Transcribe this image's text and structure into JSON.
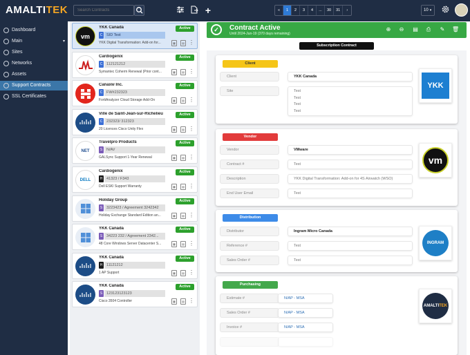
{
  "app": {
    "logo_part1": "AMALTI",
    "logo_part2": "TEK"
  },
  "search": {
    "placeholder": "Search Contracts"
  },
  "pager": {
    "pages": [
      "1",
      "2",
      "3",
      "4",
      "...",
      "30",
      "31"
    ],
    "prev": "‹",
    "next": "›",
    "first": "«",
    "last": "»"
  },
  "page_size": "10",
  "sidebar": {
    "items": [
      {
        "label": "Dashboard"
      },
      {
        "label": "Main"
      },
      {
        "label": "Sites"
      },
      {
        "label": "Networks"
      },
      {
        "label": "Assets"
      },
      {
        "label": "Support Contracts"
      },
      {
        "label": "SSL Certificates"
      }
    ]
  },
  "contracts": [
    {
      "name": "YKK Canada",
      "type": "C",
      "ref": "SID Test",
      "desc": "YKK Digital Transformation: Add-on for...",
      "status": "Active",
      "logo": "vm"
    },
    {
      "name": "Cardiogenix",
      "type": "C",
      "ref": "112121212",
      "desc": "Symantec Coherm Renewal (Prior cont...",
      "status": "Active",
      "logo": "broadcom"
    },
    {
      "name": "Canaxw Inc.",
      "type": "C",
      "ref": "FW#232323",
      "desc": "FortiAnalyzer Cloud Storage Add-On",
      "status": "Active",
      "logo": "fortinet"
    },
    {
      "name": "Ville de Saint-Jean-sur-Richelieu",
      "type": "C",
      "ref": "232323/ 312323",
      "desc": "20 Licences Cisco Unity Flex",
      "status": "Active",
      "logo": "cisco"
    },
    {
      "name": "Travelpro Products",
      "type": "S",
      "ref": "N/AV",
      "desc": "GALSync Support 1-Year Renewal",
      "status": "Active",
      "logo": "netiq"
    },
    {
      "name": "Cardiogenix",
      "type": "H",
      "ref": "41323 / F343",
      "desc": "Dell ESKI Support Warranty",
      "status": "Active",
      "logo": "dell"
    },
    {
      "name": "Holiday Group",
      "type": "S",
      "ref": "3223423 / Agreement 3242342",
      "desc": "Holiday Exchange Standard Edition an...",
      "status": "Active",
      "logo": "windows"
    },
    {
      "name": "YKK Canada",
      "type": "S",
      "ref": "34223 232 / Agreement 2342...",
      "desc": "48 Core Windows Server Datacenter S...",
      "status": "Active",
      "logo": "windows"
    },
    {
      "name": "YKK Canada",
      "type": "H",
      "ref": "11121212",
      "desc": "1 AP Support",
      "status": "Active",
      "logo": "cisco"
    },
    {
      "name": "YKK Canada",
      "type": "S",
      "ref": "123123123123",
      "desc": "Cisco 3504 Controller",
      "status": "Active",
      "logo": "cisco"
    }
  ],
  "banner": {
    "title": "Contract Active",
    "subtitle": "Until 2024-Jun-19 (370 days remaining)"
  },
  "tab_label": "Subscription Contract",
  "client": {
    "tag": "Client",
    "client_label": "Client",
    "client_value": "YKK Canada",
    "site_label": "Site",
    "site_values": [
      "Test",
      "Test",
      "Test",
      "Test"
    ],
    "logo_text": "YKK"
  },
  "vendor": {
    "tag": "Vendor",
    "vendor_label": "Vendor",
    "vendor_value": "VMware",
    "contract_label": "Contract #",
    "contract_value": "Test",
    "description_label": "Description",
    "description_value": "YKK Digital Transformation: Add-on for 4S Airwatch (WSO)",
    "email_label": "End User Email",
    "email_value": "Test",
    "logo_text": "vm"
  },
  "distribution": {
    "tag": "Distribution",
    "distributor_label": "Distributor",
    "distributor_value": "Ingram Micro Canada",
    "reference_label": "Reference #",
    "reference_value": "Test",
    "sales_order_label": "Sales Order #",
    "sales_order_value": "Test",
    "logo_text": "INGRAM"
  },
  "purchasing": {
    "tag": "Purchasing",
    "estimate_label": "Estimate #",
    "estimate_value": "N/AP - MSA",
    "sales_order_label": "Sales Order #",
    "sales_order_value": "N/AP - MSA",
    "invoice_label": "Invoice #",
    "invoice_value": "N/AP - MSA",
    "logo_part1": "AMALTI",
    "logo_part2": "TEK"
  },
  "colors": {
    "sidebar": "#1f2d44",
    "active_green": "#37a844",
    "accent_blue": "#2e7bd6",
    "vendor_red": "#e23b3b",
    "client_yellow": "#f5c518",
    "distribution_blue": "#3d8be8",
    "purchasing_green": "#43a84b"
  }
}
